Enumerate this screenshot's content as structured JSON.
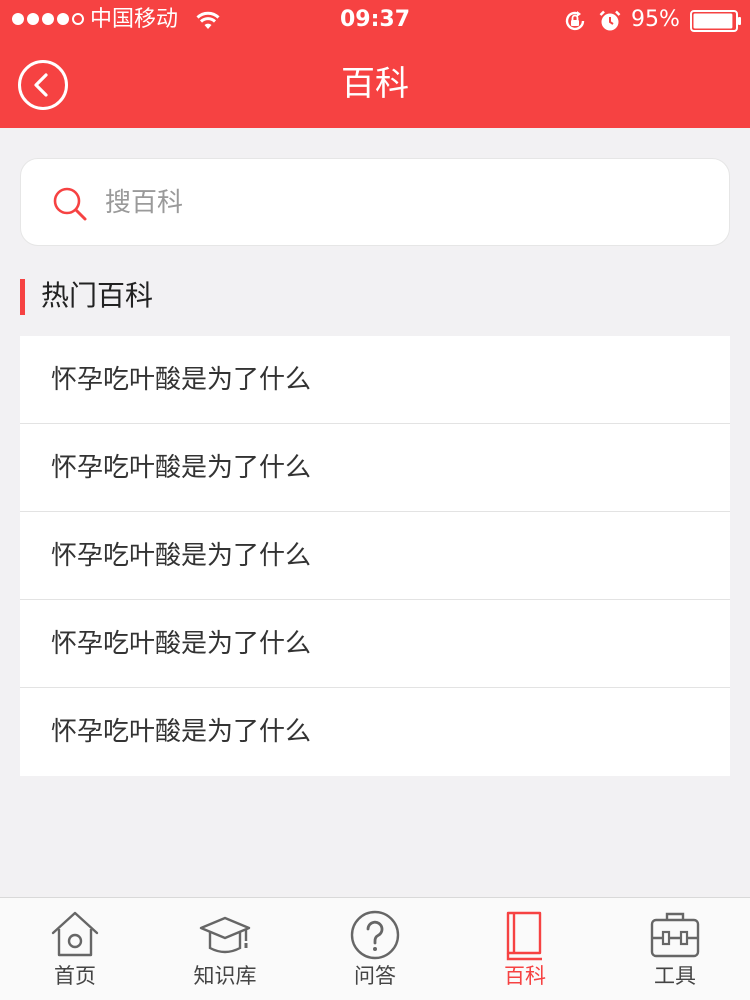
{
  "status_bar": {
    "carrier": "中国移动",
    "time": "09:37",
    "battery": "95%",
    "battery_level": 0.95
  },
  "nav": {
    "title": "百科",
    "back_icon": "back-chevron-icon"
  },
  "search": {
    "placeholder": "搜百科",
    "value": "",
    "icon": "search-icon"
  },
  "section": {
    "title": "热门百科"
  },
  "topics": [
    {
      "label": "怀孕吃叶酸是为了什么"
    },
    {
      "label": "怀孕吃叶酸是为了什么"
    },
    {
      "label": "怀孕吃叶酸是为了什么"
    },
    {
      "label": "怀孕吃叶酸是为了什么"
    },
    {
      "label": "怀孕吃叶酸是为了什么"
    }
  ],
  "tabs": [
    {
      "label": "首页",
      "icon": "home-icon",
      "active": false
    },
    {
      "label": "知识库",
      "icon": "graduation-cap-icon",
      "active": false
    },
    {
      "label": "问答",
      "icon": "question-circle-icon",
      "active": false
    },
    {
      "label": "百科",
      "icon": "book-icon",
      "active": true
    },
    {
      "label": "工具",
      "icon": "toolbox-icon",
      "active": false
    }
  ],
  "colors": {
    "accent": "#f64242",
    "background": "#f2f1f3",
    "tab_inactive": "#444444"
  }
}
